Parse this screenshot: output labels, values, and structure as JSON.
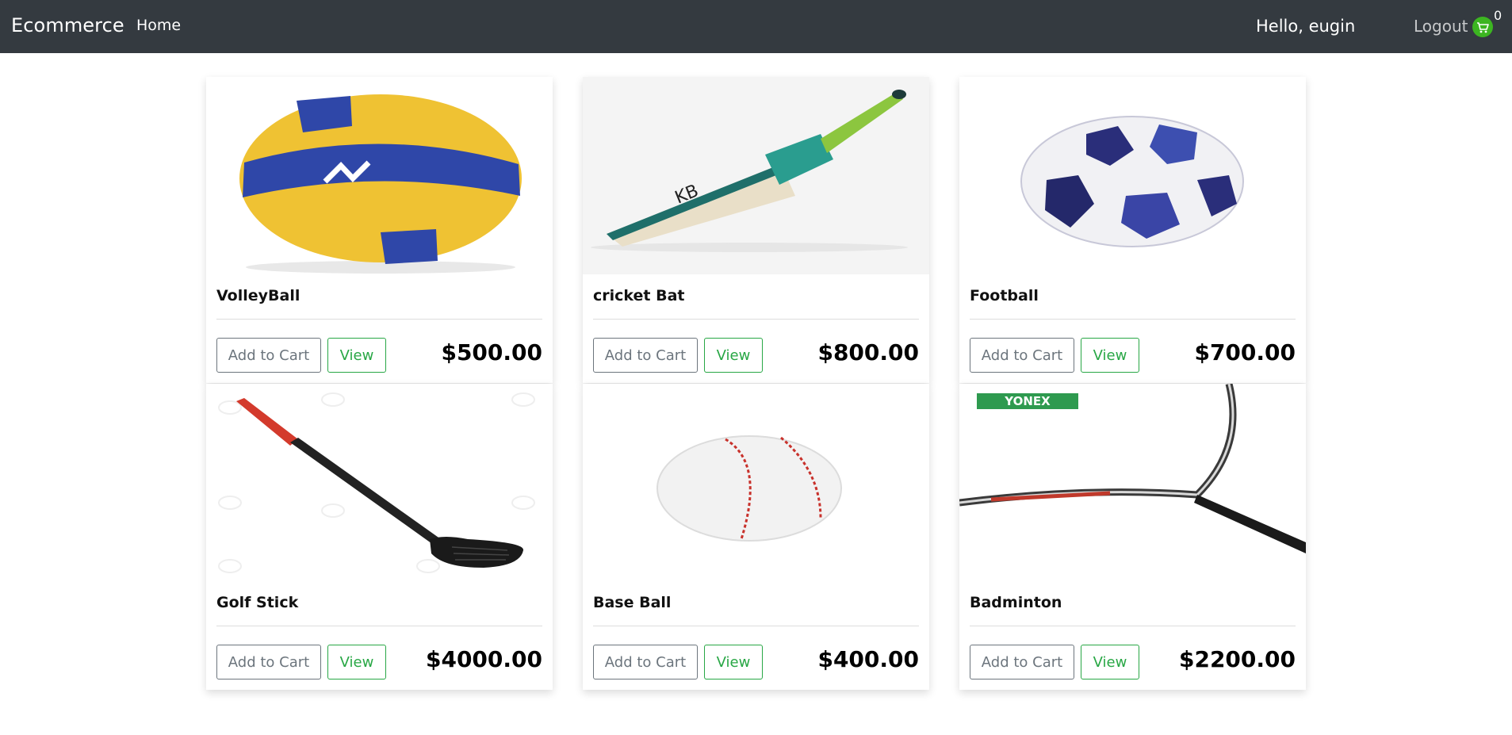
{
  "navbar": {
    "brand": "Ecommerce",
    "home_label": "Home",
    "greeting": "Hello, eugin",
    "logout_label": "Logout",
    "cart_icon": "cart-icon",
    "cart_count": "0"
  },
  "products": [
    {
      "name": "VolleyBall",
      "price": "$500.00",
      "add_label": "Add to Cart",
      "view_label": "View",
      "image": "volleyball"
    },
    {
      "name": "cricket Bat",
      "price": "$800.00",
      "add_label": "Add to Cart",
      "view_label": "View",
      "image": "cricket-bat"
    },
    {
      "name": "Football",
      "price": "$700.00",
      "add_label": "Add to Cart",
      "view_label": "View",
      "image": "football"
    },
    {
      "name": "Golf Stick",
      "price": "$4000.00",
      "add_label": "Add to Cart",
      "view_label": "View",
      "image": "golf-stick"
    },
    {
      "name": "Base Ball",
      "price": "$400.00",
      "add_label": "Add to Cart",
      "view_label": "View",
      "image": "baseball"
    },
    {
      "name": "Badminton",
      "price": "$2200.00",
      "add_label": "Add to Cart",
      "view_label": "View",
      "image": "badminton-racket",
      "image_text": "YONEX"
    }
  ],
  "colors": {
    "navbar": "#343a40",
    "cart_badge": "#3cb521",
    "view_button": "#28a745",
    "cart_button": "#6c757d"
  }
}
